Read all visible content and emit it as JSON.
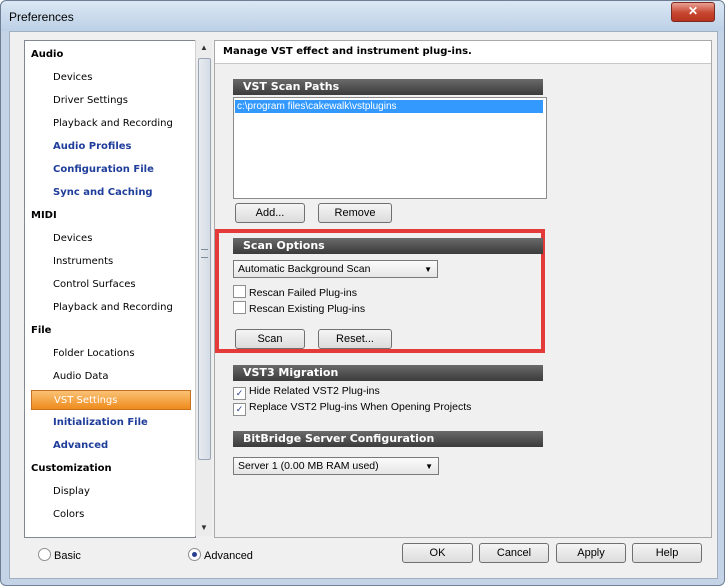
{
  "window": {
    "title": "Preferences",
    "close_glyph": "✕"
  },
  "tree": [
    {
      "label": "Audio",
      "kind": "cat"
    },
    {
      "label": "Devices",
      "kind": "sub"
    },
    {
      "label": "Driver Settings",
      "kind": "sub"
    },
    {
      "label": "Playback and Recording",
      "kind": "sub"
    },
    {
      "label": "Audio Profiles",
      "kind": "blue"
    },
    {
      "label": "Configuration File",
      "kind": "blue"
    },
    {
      "label": "Sync and Caching",
      "kind": "blue"
    },
    {
      "label": "MIDI",
      "kind": "cat"
    },
    {
      "label": "Devices",
      "kind": "sub"
    },
    {
      "label": "Instruments",
      "kind": "sub"
    },
    {
      "label": "Control Surfaces",
      "kind": "sub"
    },
    {
      "label": "Playback and Recording",
      "kind": "sub"
    },
    {
      "label": "File",
      "kind": "cat"
    },
    {
      "label": "Folder Locations",
      "kind": "sub"
    },
    {
      "label": "Audio Data",
      "kind": "sub"
    },
    {
      "label": "VST Settings",
      "kind": "selected"
    },
    {
      "label": "Initialization File",
      "kind": "blue"
    },
    {
      "label": "Advanced",
      "kind": "blue"
    },
    {
      "label": "Customization",
      "kind": "cat"
    },
    {
      "label": "Display",
      "kind": "sub"
    },
    {
      "label": "Colors",
      "kind": "sub"
    }
  ],
  "content": {
    "header": "Manage VST effect and instrument plug-ins.",
    "scan_paths": {
      "title": "VST Scan Paths",
      "paths": [
        "c:\\program files\\cakewalk\\vstplugins"
      ],
      "add_label": "Add...",
      "remove_label": "Remove"
    },
    "scan_options": {
      "title": "Scan Options",
      "mode": "Automatic Background Scan",
      "rescan_failed": "Rescan Failed Plug-ins",
      "rescan_existing": "Rescan Existing Plug-ins",
      "scan_label": "Scan",
      "reset_label": "Reset..."
    },
    "vst3": {
      "title": "VST3 Migration",
      "hide_related": "Hide Related VST2 Plug-ins",
      "replace": "Replace VST2 Plug-ins When Opening Projects",
      "check_glyph": "✓"
    },
    "bitbridge": {
      "title": "BitBridge Server Configuration",
      "server": "Server 1  (0.00  MB RAM used)"
    },
    "dropdown_glyph": "▼"
  },
  "footer": {
    "basic_label": "Basic",
    "advanced_label": "Advanced",
    "ok_label": "OK",
    "cancel_label": "Cancel",
    "apply_label": "Apply",
    "help_label": "Help"
  },
  "scroll": {
    "up_glyph": "▲",
    "down_glyph": "▼"
  },
  "colors": {
    "highlight": "#e53a3a",
    "selection": "#ef8a1c",
    "link_blue": "#1f3d9a"
  }
}
